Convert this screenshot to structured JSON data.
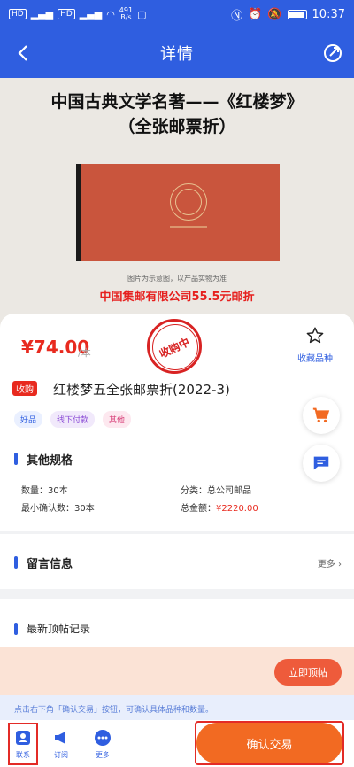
{
  "status": {
    "signal1": "HD",
    "signal2": "HD",
    "net_speed": "491",
    "net_unit": "B/s",
    "battery": "",
    "time": "10:37"
  },
  "nav": {
    "title": "详情"
  },
  "image": {
    "title_line1": "中国古典文学名著——《红楼梦》",
    "title_line2": "（全张邮票折）",
    "note": "图片为示意图，以产品实物为准",
    "price_line": "中国集邮有限公司55.5元邮折"
  },
  "product": {
    "price": "¥74.00",
    "unit": "/本",
    "seal_text": "收购中",
    "favorite_label": "收藏品种",
    "buy_tag": "收购",
    "title": "红楼梦五全张邮票折(2022-3)",
    "tags": [
      "好品",
      "线下付款",
      "其他"
    ]
  },
  "specs": {
    "title": "其他规格",
    "quantity_label": "数量：",
    "quantity": "30本",
    "category_label": "分类：",
    "category": "总公司邮品",
    "min_label": "最小确认数：",
    "min": "30本",
    "total_label": "总金额：",
    "total": "¥2220.00"
  },
  "messages": {
    "title": "留言信息",
    "more": "更多"
  },
  "top_records": {
    "title": "最新顶帖记录",
    "button": "立即顶帖"
  },
  "hint": "点击右下角「确认交易」按钮，可确认具体品种和数量。",
  "bottom": {
    "contact": "联系",
    "subscribe": "订阅",
    "more": "更多",
    "confirm": "确认交易"
  },
  "colors": {
    "primary": "#2f5ee0",
    "price_red": "#e82a1f",
    "confirm_orange": "#f26a22"
  }
}
